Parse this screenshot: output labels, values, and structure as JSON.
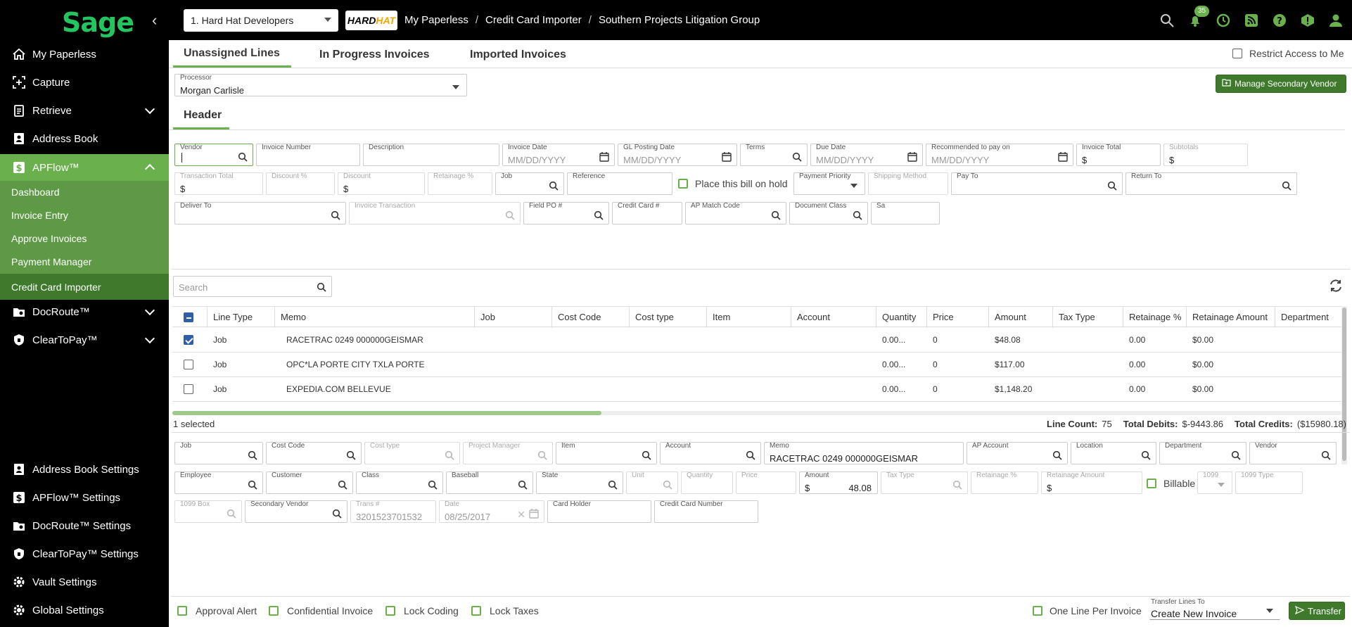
{
  "topbar": {
    "logo": "Sage",
    "company": "1. Hard Hat Developers",
    "company_logo": {
      "main": "HARD",
      "accent": "HAT"
    },
    "breadcrumbs": [
      "My Paperless",
      "Credit Card Importer",
      "Southern Projects Litigation Group"
    ],
    "breadcrumb_sep": "/",
    "notification_count": "35",
    "icons": [
      "search-icon",
      "bell-icon",
      "history-icon",
      "rss-icon",
      "help-icon",
      "alert-icon",
      "user-icon"
    ]
  },
  "sidebar": {
    "items": [
      {
        "label": "My Paperless",
        "icon": "home-icon"
      },
      {
        "label": "Capture",
        "icon": "capture-icon"
      },
      {
        "label": "Retrieve",
        "icon": "clipboard-icon"
      },
      {
        "label": "Address Book",
        "icon": "address-book-icon"
      },
      {
        "label": "APFlow™",
        "icon": "dollar-icon"
      },
      {
        "label": "DocRoute™",
        "icon": "folder-gear-icon"
      },
      {
        "label": "ClearToPay™",
        "icon": "shield-icon"
      }
    ],
    "apflow_sub": [
      "Dashboard",
      "Invoice Entry",
      "Approve Invoices",
      "Payment Manager",
      "Credit Card Importer"
    ],
    "settings": [
      {
        "label": "Address Book Settings",
        "icon": "address-book-icon"
      },
      {
        "label": "APFlow™ Settings",
        "icon": "dollar-icon"
      },
      {
        "label": "DocRoute™ Settings",
        "icon": "folder-gear-icon"
      },
      {
        "label": "ClearToPay™ Settings",
        "icon": "shield-icon"
      },
      {
        "label": "Vault Settings",
        "icon": "gear-icon"
      },
      {
        "label": "Global Settings",
        "icon": "gear-icon"
      }
    ]
  },
  "tabs": [
    "Unassigned Lines",
    "In Progress Invoices",
    "Imported Invoices"
  ],
  "restrict_label": "Restrict Access to Me",
  "processor": {
    "label": "Processor",
    "value": "Morgan Carlisle"
  },
  "manage_vendor_label": "Manage Secondary Vendor",
  "header_tab": "Header",
  "header_fields": {
    "vendor": "Vendor",
    "invoice_number": "Invoice Number",
    "description": "Description",
    "invoice_date": "Invoice Date",
    "gl_posting_date": "GL Posting Date",
    "terms": "Terms",
    "due_date": "Due Date",
    "recommended": "Recommended to pay on",
    "invoice_total": "Invoice Total",
    "subtotals": "Subtotals",
    "transaction_total": "Transaction Total",
    "discount_pct": "Discount %",
    "discount": "Discount",
    "retainage_pct": "Retainage %",
    "job": "Job",
    "reference": "Reference",
    "place_on_hold": "Place this bill on hold",
    "payment_priority": "Payment Priority",
    "shipping_method": "Shipping Method",
    "pay_to": "Pay To",
    "return_to": "Return To",
    "deliver_to": "Deliver To",
    "invoice_transaction": "Invoice Transaction",
    "field_po": "Field PO #",
    "credit_card": "Credit Card #",
    "ap_match_code": "AP Match Code",
    "document_class": "Document Class",
    "sa": "Sa",
    "date_placeholder": "MM/DD/YYYY",
    "currency": "$"
  },
  "search_placeholder": "Search",
  "grid": {
    "columns": [
      "Line Type",
      "Memo",
      "Job",
      "Cost Code",
      "Cost type",
      "Item",
      "Account",
      "Quantity",
      "Price",
      "Amount",
      "Tax Type",
      "Retainage %",
      "Retainage Amount",
      "Department"
    ],
    "rows": [
      {
        "checked": true,
        "line_type": "Job",
        "memo": "RACETRAC 0249 000000GEISMAR",
        "quantity": "0.00...",
        "price": "0",
        "amount": "$48.08",
        "retainage_pct": "0.00",
        "retainage_amount": "$0.00"
      },
      {
        "checked": false,
        "line_type": "Job",
        "memo": "OPC*LA PORTE CITY TXLA PORTE",
        "quantity": "0.00...",
        "price": "0",
        "amount": "$117.00",
        "retainage_pct": "0.00",
        "retainage_amount": "$0.00"
      },
      {
        "checked": false,
        "line_type": "Job",
        "memo": "EXPEDIA.COM BELLEVUE",
        "quantity": "0.00...",
        "price": "0",
        "amount": "$1,148.20",
        "retainage_pct": "0.00",
        "retainage_amount": "$0.00"
      }
    ]
  },
  "summary": {
    "selected": "1 selected",
    "line_count_label": "Line Count:",
    "line_count": "75",
    "debits_label": "Total Debits:",
    "debits": "$-9443.86",
    "credits_label": "Total Credits:",
    "credits": "($15980.18)"
  },
  "detail": {
    "job": "Job",
    "cost_code": "Cost Code",
    "cost_type": "Cost type",
    "project_manager": "Project Manager",
    "item": "Item",
    "account": "Account",
    "memo": "Memo",
    "memo_value": "RACETRAC 0249 000000GEISMAR",
    "ap_account": "AP Account",
    "location": "Location",
    "department": "Department",
    "vendor": "Vendor",
    "employee": "Employee",
    "customer": "Customer",
    "class": "Class",
    "baseball": "Baseball",
    "state": "State",
    "unit": "Unit",
    "quantity": "Quantity",
    "price": "Price",
    "amount": "Amount",
    "amount_value": "48.08",
    "tax_type": "Tax Type",
    "retainage_pct": "Retainage %",
    "retainage_amount": "Retainage Amount",
    "billable": "Billable",
    "f1099": "1099",
    "f1099_type": "1099 Type",
    "f1099_box": "1099 Box",
    "secondary_vendor": "Secondary Vendor",
    "trans": "Trans #",
    "trans_value": "3201523701532",
    "date": "Date",
    "date_value": "08/25/2017",
    "card_holder": "Card Holder",
    "card_number": "Credit Card Number",
    "currency": "$"
  },
  "footer": {
    "approval_alert": "Approval Alert",
    "confidential": "Confidential Invoice",
    "lock_coding": "Lock Coding",
    "lock_taxes": "Lock Taxes",
    "one_line": "One Line Per Invoice",
    "transfer_label": "Transfer Lines To",
    "transfer_value": "Create New Invoice",
    "transfer_button": "Transfer"
  },
  "colors": {
    "accent": "#6ab04c",
    "dark_green": "#3f7a2c",
    "topbar": "#000000"
  }
}
